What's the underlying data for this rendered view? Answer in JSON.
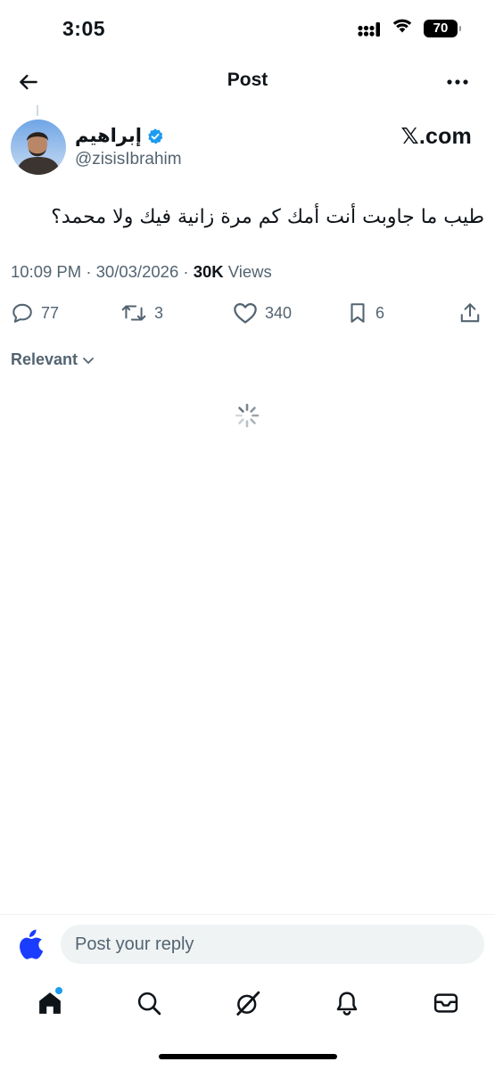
{
  "status_bar": {
    "time": "3:05",
    "battery": "70"
  },
  "header": {
    "title": "Post",
    "back_icon": "arrow-left-icon",
    "more_icon": "ellipsis-icon"
  },
  "post": {
    "author_name": "إبراهيم",
    "author_handle": "@zisisIbrahim",
    "verified": true,
    "watermark": "𝕏.com",
    "text": "طيب ما جاوبت أنت أمك كم مرة زانية فيك ولا محمد؟",
    "time": "10:09 PM",
    "separator": "·",
    "date": "30/03/2026",
    "views_count": "30K",
    "views_label": "Views"
  },
  "actions": {
    "replies": "77",
    "reposts": "3",
    "likes": "340",
    "bookmarks": "6"
  },
  "sort": {
    "label": "Relevant"
  },
  "reply_bar": {
    "placeholder": "Post your reply"
  },
  "tabbar": {
    "items": [
      "home-icon",
      "search-icon",
      "grok-icon",
      "notifications-icon",
      "messages-icon"
    ]
  },
  "colors": {
    "accent": "#1d9bf0",
    "text": "#0f1419",
    "secondary": "#536471",
    "reply_bg": "#eff3f4",
    "apple_blue": "#1a3cff"
  }
}
